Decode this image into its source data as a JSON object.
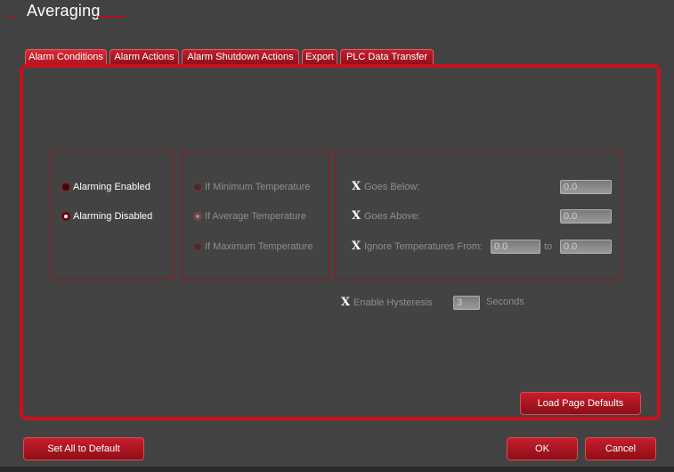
{
  "group_title": "Averaging",
  "tabs": [
    {
      "label": "Alarm Conditions"
    },
    {
      "label": "Alarm Actions"
    },
    {
      "label": "Alarm Shutdown Actions"
    },
    {
      "label": "Export"
    },
    {
      "label": "PLC Data Transfer"
    }
  ],
  "alarming": {
    "enabled_label": "Alarming Enabled",
    "disabled_label": "Alarming Disabled",
    "selected": "disabled"
  },
  "temperature_mode": {
    "min_label": "If Minimum Temperature",
    "avg_label": "If Average Temperature",
    "max_label": "If Maximum Temperature",
    "selected": "average"
  },
  "conditions": {
    "goes_below_label": "Goes Below:",
    "goes_below_value": "0.0",
    "goes_above_label": "Goes Above:",
    "goes_above_value": "0.0",
    "ignore_label": "Ignore Temperatures From:",
    "ignore_from_value": "0.0",
    "to_label": "to",
    "ignore_to_value": "0.0",
    "check_mark": "X"
  },
  "hysteresis": {
    "label": "Enable Hysteresis",
    "value": "3",
    "unit": "Seconds"
  },
  "buttons": {
    "load_defaults": "Load Page Defaults",
    "set_all_default": "Set All to Default",
    "ok": "OK",
    "cancel": "Cancel"
  },
  "colors": {
    "accent": "#c8101e",
    "background": "#424242"
  }
}
